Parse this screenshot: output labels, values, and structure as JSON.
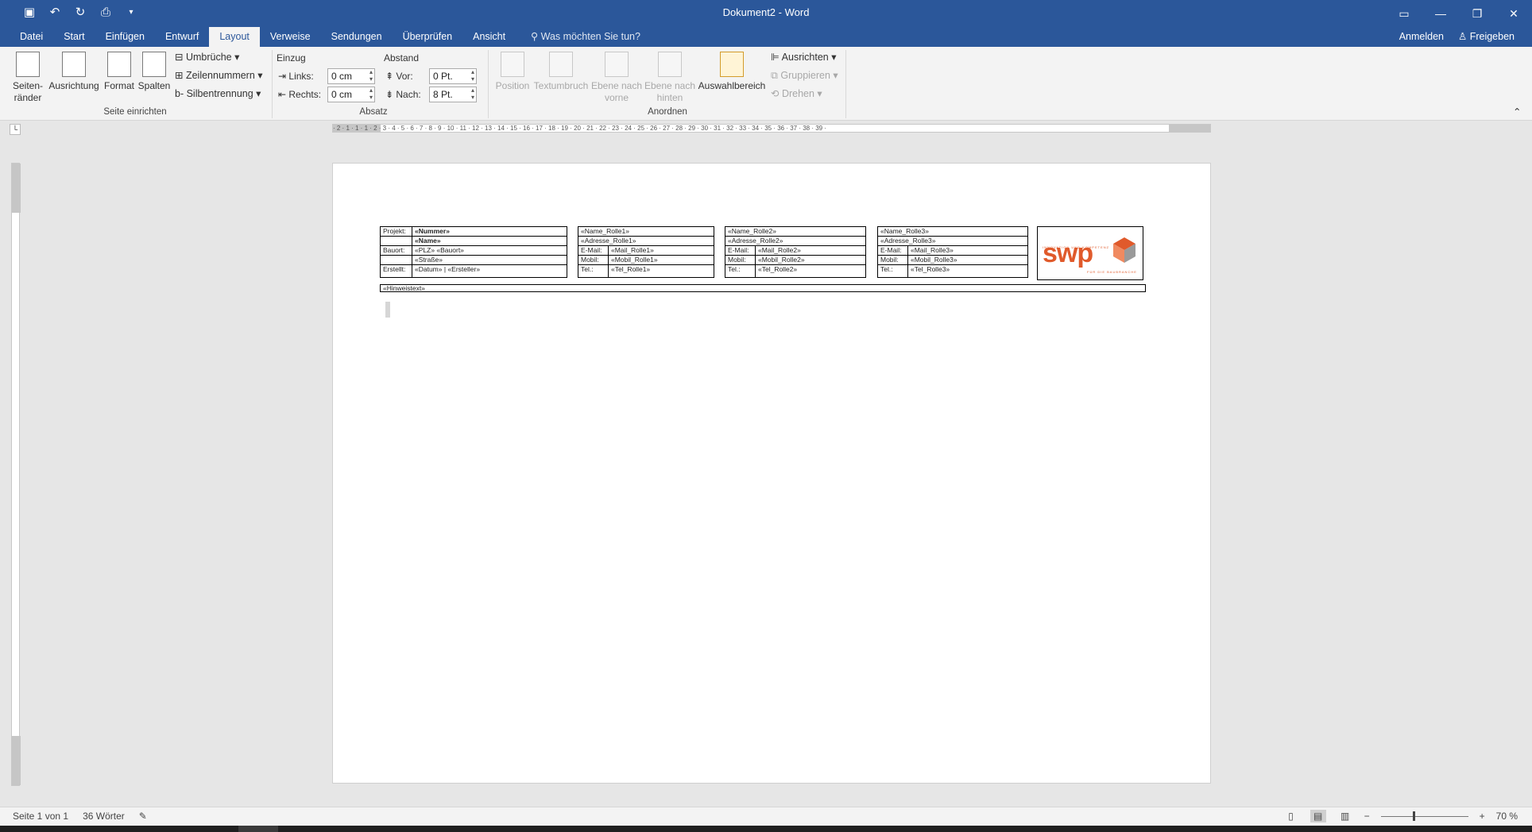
{
  "window": {
    "title": "Dokument2 - Word",
    "qat": [
      "save-icon",
      "undo-icon",
      "redo-icon",
      "print-preview-icon",
      "customize-icon"
    ],
    "controls": [
      "ribbon-display-icon",
      "minimize-icon",
      "restore-icon",
      "close-icon"
    ]
  },
  "tabs": [
    {
      "label": "Datei"
    },
    {
      "label": "Start"
    },
    {
      "label": "Einfügen"
    },
    {
      "label": "Entwurf"
    },
    {
      "label": "Layout",
      "active": true
    },
    {
      "label": "Verweise"
    },
    {
      "label": "Sendungen"
    },
    {
      "label": "Überprüfen"
    },
    {
      "label": "Ansicht"
    }
  ],
  "tellme": "Was möchten Sie tun?",
  "account": {
    "signin": "Anmelden",
    "share": "Freigeben"
  },
  "ribbon": {
    "seite": {
      "label": "Seite einrichten",
      "margins": "Seiten-\nränder",
      "orientation": "Ausrichtung",
      "size": "Format",
      "columns": "Spalten",
      "breaks": "Umbrüche",
      "line_numbers": "Zeilennummern",
      "hyphenation": "Silbentrennung"
    },
    "absatz": {
      "label": "Absatz",
      "indent_title": "Einzug",
      "left_label": "Links:",
      "left_value": "0 cm",
      "right_label": "Rechts:",
      "right_value": "0 cm",
      "spacing_title": "Abstand",
      "before_label": "Vor:",
      "before_value": "0 Pt.",
      "after_label": "Nach:",
      "after_value": "8 Pt."
    },
    "anordnen": {
      "label": "Anordnen",
      "position": "Position",
      "wrap": "Textumbruch",
      "forward": "Ebene nach\nvorne",
      "backward": "Ebene nach\nhinten",
      "selection": "Auswahlbereich",
      "align": "Ausrichten",
      "group": "Gruppieren",
      "rotate": "Drehen"
    }
  },
  "ruler": "· 2 · 1 · 1 · 1 · 2 · 3 · 4 · 5 · 6 · 7 · 8 · 9 · 10 · 11 · 12 · 13 · 14 · 15 · 16 · 17 · 18 · 19 · 20 · 21 · 22 · 23 · 24 · 25 · 26 · 27 · 28 · 29 · 30 · 31 · 32 · 33 · 34 · 35 · 36 · 37 · 38 · 39 ·",
  "document": {
    "projekt": {
      "rows": [
        [
          "Projekt:",
          "«Nummer»"
        ],
        [
          "",
          "«Name»"
        ],
        [
          "Bauort:",
          "«PLZ» «Bauort»"
        ],
        [
          "",
          "«Straße»"
        ],
        [
          "Erstellt:",
          "«Datum» | «Ersteller»"
        ]
      ]
    },
    "rollen": [
      {
        "name": "«Name_Rolle1»",
        "adresse": "«Adresse_Rolle1»",
        "email_label": "E-Mail:",
        "email": "«Mail_Rolle1»",
        "mobil_label": "Mobil:",
        "mobil": "«Mobil_Rolle1»",
        "tel_label": "Tel.:",
        "tel": "«Tel_Rolle1»"
      },
      {
        "name": "«Name_Rolle2»",
        "adresse": "«Adresse_Rolle2»",
        "email_label": "E-Mail:",
        "email": "«Mail_Rolle2»",
        "mobil_label": "Mobil:",
        "mobil": "«Mobil_Rolle2»",
        "tel_label": "Tel.:",
        "tel": "«Tel_Rolle2»"
      },
      {
        "name": "«Name_Rolle3»",
        "adresse": "«Adresse_Rolle3»",
        "email_label": "E-Mail:",
        "email": "«Mail_Rolle3»",
        "mobil_label": "Mobil:",
        "mobil": "«Mobil_Rolle3»",
        "tel_label": "Tel.:",
        "tel": "«Tel_Rolle3»"
      }
    ],
    "logo": {
      "text": "swp",
      "tagline_top": "INNOVATION UND KOMPETENZ",
      "tagline_bottom": "FÜR DIE BAUBRANCHE"
    },
    "hinweis": "«Hinweistext»"
  },
  "status": {
    "page": "Seite 1 von 1",
    "words": "36 Wörter",
    "zoom": "70 %"
  },
  "colors": {
    "accent": "#2b579a",
    "logo": "#e05a2b"
  }
}
